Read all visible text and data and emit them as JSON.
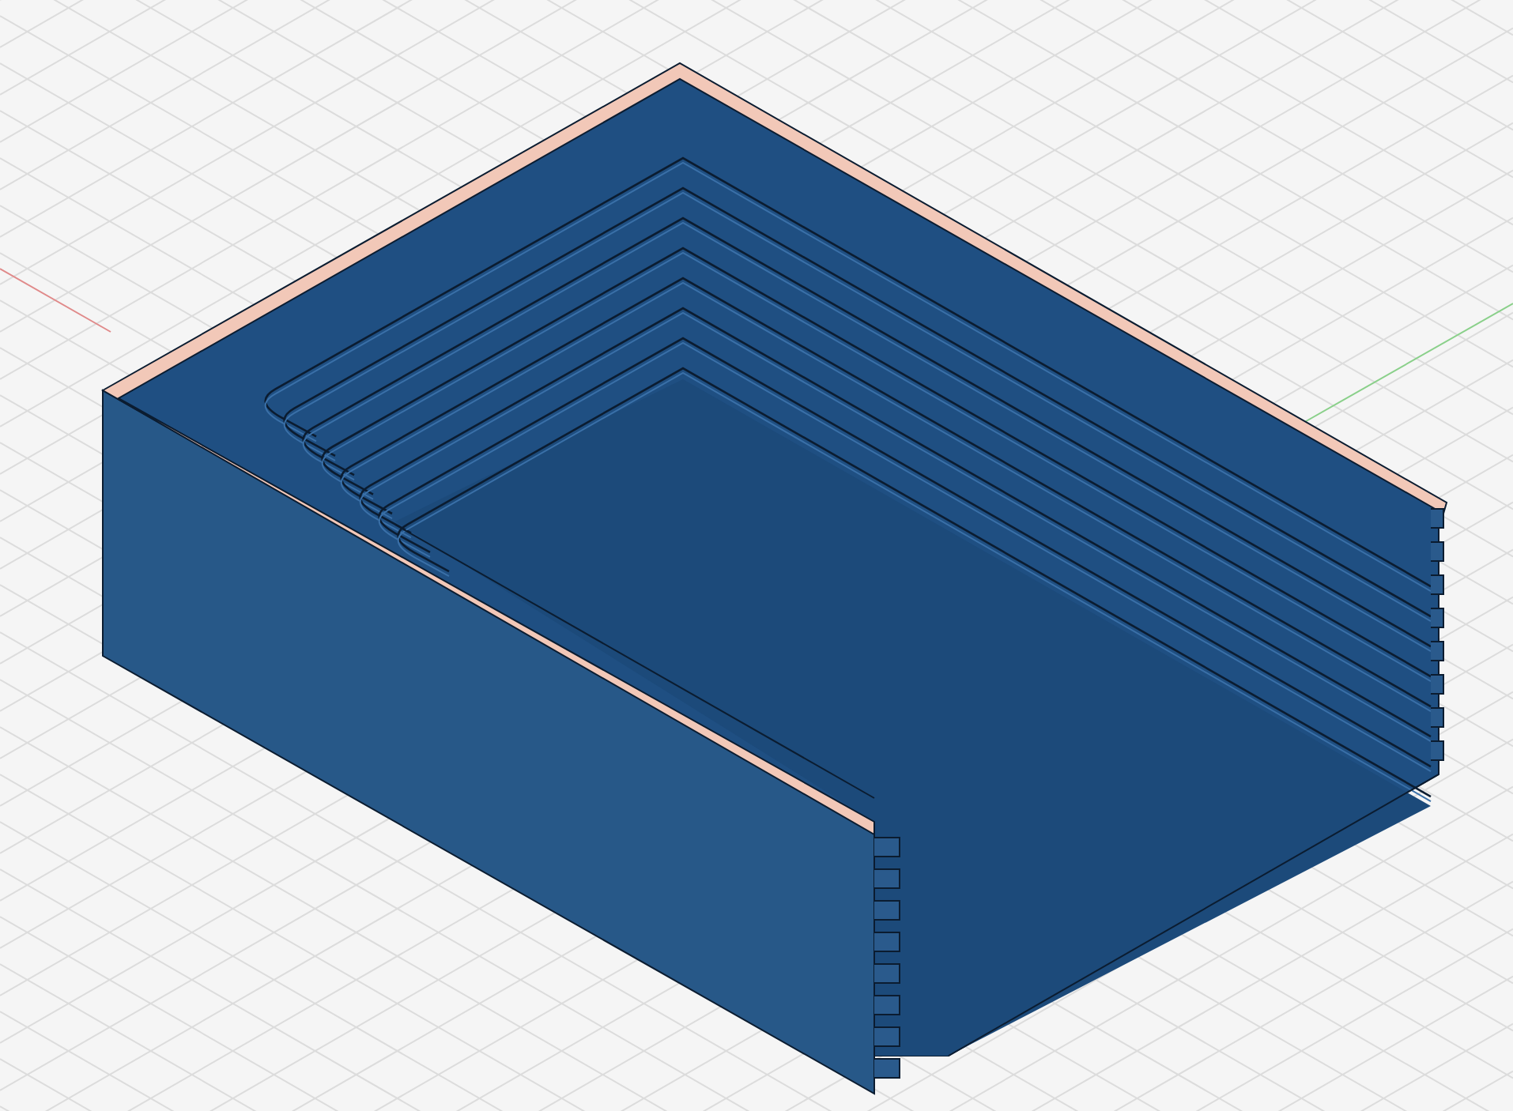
{
  "viewport": {
    "grid": true,
    "axes": true
  },
  "model": {
    "kind": "tray"
  }
}
